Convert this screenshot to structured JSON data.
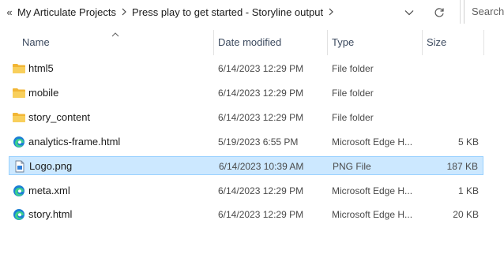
{
  "address": {
    "overflow": "«",
    "crumbs": [
      "My Articulate Projects",
      "Press play to get started - Storyline output"
    ],
    "search_placeholder": "Search P"
  },
  "columns": {
    "name": "Name",
    "date": "Date modified",
    "type": "Type",
    "size": "Size"
  },
  "files": [
    {
      "name": "html5",
      "date": "6/14/2023 12:29 PM",
      "type": "File folder",
      "size": "",
      "icon": "folder-icon"
    },
    {
      "name": "mobile",
      "date": "6/14/2023 12:29 PM",
      "type": "File folder",
      "size": "",
      "icon": "folder-icon"
    },
    {
      "name": "story_content",
      "date": "6/14/2023 12:29 PM",
      "type": "File folder",
      "size": "",
      "icon": "folder-icon"
    },
    {
      "name": "analytics-frame.html",
      "date": "5/19/2023 6:55 PM",
      "type": "Microsoft Edge H...",
      "size": "5 KB",
      "icon": "edge-icon"
    },
    {
      "name": "Logo.png",
      "date": "6/14/2023 10:39 AM",
      "type": "PNG File",
      "size": "187 KB",
      "icon": "png-file-icon",
      "selected": true
    },
    {
      "name": "meta.xml",
      "date": "6/14/2023 12:29 PM",
      "type": "Microsoft Edge H...",
      "size": "1 KB",
      "icon": "edge-icon"
    },
    {
      "name": "story.html",
      "date": "6/14/2023 12:29 PM",
      "type": "Microsoft Edge H...",
      "size": "20 KB",
      "icon": "edge-icon"
    }
  ],
  "colors": {
    "selection_bg": "#cce8ff",
    "selection_border": "#99d1ff",
    "folder": "#f7c948",
    "edge": "#1b7fd4"
  }
}
